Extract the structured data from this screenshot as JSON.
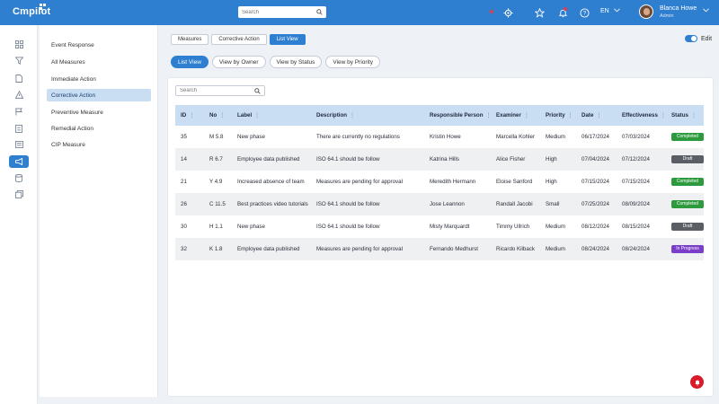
{
  "app": {
    "logo_text": "mpilot",
    "logo_initial": "C"
  },
  "topbar": {
    "search_placeholder": "Search",
    "language": "EN",
    "user_name": "Blanca Howe",
    "user_role": "Admin",
    "icons": [
      "search-icon",
      "gear-icon",
      "star-icon",
      "bell-icon",
      "help-icon"
    ]
  },
  "tabs": [
    {
      "label": "Measures"
    },
    {
      "label": "Corrective Action"
    },
    {
      "label": "List View"
    }
  ],
  "edit_label": "Edit",
  "views": [
    {
      "label": "List View"
    },
    {
      "label": "View by Owner"
    },
    {
      "label": "View by Status"
    },
    {
      "label": "View by Priority"
    }
  ],
  "subnav": {
    "items": [
      {
        "label": "Event Response"
      },
      {
        "label": "All Measures"
      },
      {
        "label": "Immediate Action"
      },
      {
        "label": "Corrective Action"
      },
      {
        "label": "Preventive Measure"
      },
      {
        "label": "Remedial Action"
      },
      {
        "label": "CIP Measure"
      }
    ]
  },
  "table": {
    "search_placeholder": "Search",
    "headers": [
      "ID",
      "No",
      "Label",
      "Description",
      "Responsible Person",
      "Examiner",
      "Priority",
      "Date",
      "Effectiveness",
      "Status"
    ],
    "rows": [
      {
        "id": "35",
        "no": "M 5.8",
        "label": "New phase",
        "desc": "There are currently no regulations",
        "resp": "Kristin Howe",
        "exam": "Marcella Kohler",
        "prio": "Medium",
        "date": "06/17/2024",
        "eff": "07/03/2024",
        "status": "Completed",
        "status_color": "#2e9a3e"
      },
      {
        "id": "14",
        "no": "R 6.7",
        "label": "Employee data published",
        "desc": "ISO 64.1 should be follow",
        "resp": "Katrina Hills",
        "exam": "Alice Fisher",
        "prio": "High",
        "date": "07/04/2024",
        "eff": "07/12/2024",
        "status": "Draft",
        "status_color": "#5a5f66"
      },
      {
        "id": "21",
        "no": "Y 4.9",
        "label": "Increased absence of team",
        "desc": "Measures are pending for approval",
        "resp": "Meredith Hermann",
        "exam": "Eloise Sanford",
        "prio": "High",
        "date": "07/15/2024",
        "eff": "07/15/2024",
        "status": "Completed",
        "status_color": "#2e9a3e"
      },
      {
        "id": "26",
        "no": "C 11.5",
        "label": "Best practices video tutorials",
        "desc": "ISO 64.1 should be follow",
        "resp": "Jose Leannon",
        "exam": "Randall Jacobi",
        "prio": "Small",
        "date": "07/25/2024",
        "eff": "08/09/2024",
        "status": "Completed",
        "status_color": "#2e9a3e"
      },
      {
        "id": "30",
        "no": "H 1.1",
        "label": "New phase",
        "desc": "ISO 64.1 should be follow",
        "resp": "Misty Marquardt",
        "exam": "Timmy Ullrich",
        "prio": "Medium",
        "date": "08/12/2024",
        "eff": "08/15/2024",
        "status": "Draft",
        "status_color": "#5a5f66"
      },
      {
        "id": "32",
        "no": "K 1.8",
        "label": "Employee data published",
        "desc": "Measures are pending for approval",
        "resp": "Fernando Medhurst",
        "exam": "Ricardo Kilback",
        "prio": "Medium",
        "date": "08/24/2024",
        "eff": "08/24/2024",
        "status": "In Progress",
        "status_color": "#7a3fc9"
      }
    ]
  },
  "colors": {
    "primary": "#2f7fd0",
    "header_row": "#c9ddf3",
    "fab": "#d81b2a"
  }
}
